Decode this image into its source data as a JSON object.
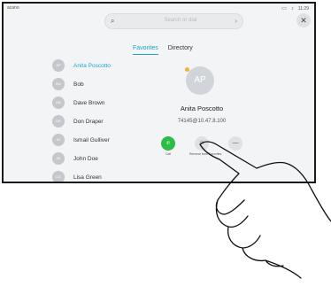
{
  "status": {
    "left_text": "acano",
    "time": "11:29"
  },
  "search": {
    "placeholder": "Search or dial"
  },
  "tabs": [
    {
      "label": "Favorites",
      "active": true
    },
    {
      "label": "Directory",
      "active": false
    }
  ],
  "contacts": [
    {
      "initials": "AP",
      "name": "Anita Poscotto",
      "selected": true
    },
    {
      "initials": "BO",
      "name": "Bob"
    },
    {
      "initials": "DB",
      "name": "Dave Brown"
    },
    {
      "initials": "DD",
      "name": "Don Draper"
    },
    {
      "initials": "IG",
      "name": "Ismail Gulliver"
    },
    {
      "initials": "JD",
      "name": "John Doe"
    },
    {
      "initials": "LG",
      "name": "Lisa Green"
    }
  ],
  "detail": {
    "initials": "AP",
    "name": "Anita Poscotto",
    "number": "74145@10.47.8.100",
    "actions": {
      "call_label": "Call",
      "favorite_label": "Remove from Favorites"
    }
  },
  "colors": {
    "accent": "#1fa3c8",
    "call_green": "#2dbc48",
    "favorite_dot": "#f1b233"
  }
}
